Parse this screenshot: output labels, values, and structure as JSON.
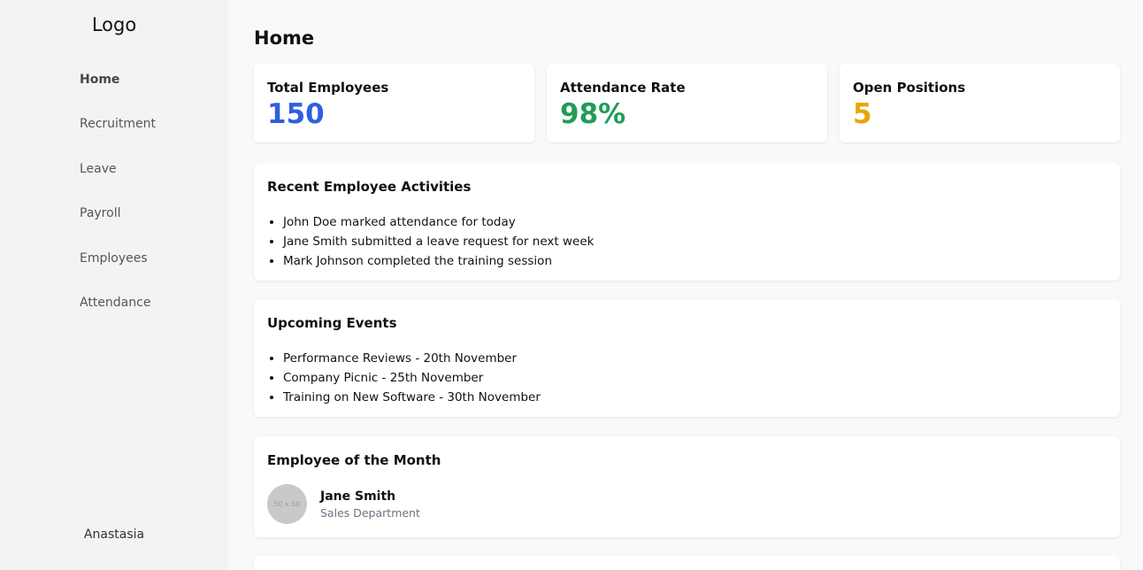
{
  "sidebar": {
    "logo": "Logo",
    "items": [
      {
        "label": "Home"
      },
      {
        "label": "Recruitment"
      },
      {
        "label": "Leave"
      },
      {
        "label": "Payroll"
      },
      {
        "label": "Employees"
      },
      {
        "label": "Attendance"
      }
    ],
    "user": "Anastasia"
  },
  "main": {
    "title": "Home",
    "stats": [
      {
        "label": "Total Employees",
        "value": "150",
        "color": "#2f5fe0"
      },
      {
        "label": "Attendance Rate",
        "value": "98%",
        "color": "#1f9d55"
      },
      {
        "label": "Open Positions",
        "value": "5",
        "color": "#e6a700"
      }
    ],
    "activities": {
      "title": "Recent Employee Activities",
      "items": [
        "John Doe marked attendance for today",
        "Jane Smith submitted a leave request for next week",
        "Mark Johnson completed the training session"
      ]
    },
    "events": {
      "title": "Upcoming Events",
      "items": [
        "Performance Reviews - 20th November",
        "Company Picnic - 25th November",
        "Training on New Software - 30th November"
      ]
    },
    "employee_of_month": {
      "title": "Employee of the Month",
      "avatar_text": "50 x 50",
      "name": "Jane Smith",
      "department": "Sales Department"
    }
  }
}
